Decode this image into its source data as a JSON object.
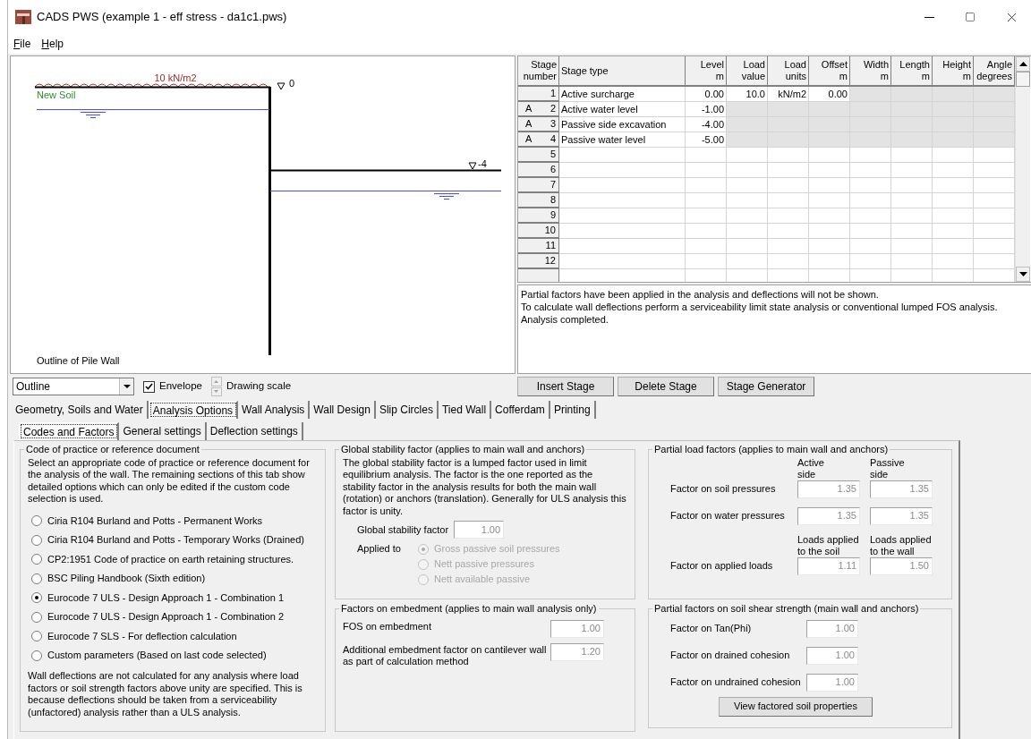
{
  "window": {
    "title": "CADS PWS (example 1 - eff stress - da1c1.pws)"
  },
  "menu": [
    "File",
    "Help"
  ],
  "drawing": {
    "load_label": "10 kN/m2",
    "soil_label": "New Soil",
    "levels": [
      "0",
      "-4"
    ],
    "caption": "Outline of Pile Wall"
  },
  "stage_table": {
    "columns": [
      {
        "lines": [
          "Stage",
          "number"
        ]
      },
      {
        "lines": [
          "Stage type"
        ]
      },
      {
        "lines": [
          "Level",
          "m"
        ]
      },
      {
        "lines": [
          "Load",
          "value"
        ]
      },
      {
        "lines": [
          "Load",
          "units"
        ]
      },
      {
        "lines": [
          "Offset",
          "m"
        ]
      },
      {
        "lines": [
          "Width",
          "m"
        ]
      },
      {
        "lines": [
          "Length",
          "m"
        ]
      },
      {
        "lines": [
          "Height",
          "m"
        ]
      },
      {
        "lines": [
          "Angle",
          "degrees"
        ]
      }
    ],
    "rows": [
      {
        "number": "1",
        "stage_type": "Active surcharge",
        "cells": [
          {
            "text": "0.00",
            "disabled": false
          },
          {
            "text": "10.0",
            "disabled": false
          },
          {
            "text": "kN/m2",
            "disabled": false
          },
          {
            "text": "0.00",
            "disabled": false
          },
          {
            "disabled": true
          },
          {
            "disabled": true
          },
          {
            "disabled": true
          },
          {
            "disabled": true
          }
        ]
      },
      {
        "marker": "A",
        "number": "2",
        "stage_type": "Active water level",
        "cells": [
          {
            "text": "-1.00",
            "disabled": false
          },
          {
            "disabled": true
          },
          {
            "disabled": true
          },
          {
            "disabled": true
          },
          {
            "disabled": true
          },
          {
            "disabled": true
          },
          {
            "disabled": true
          },
          {
            "disabled": true
          }
        ]
      },
      {
        "marker": "A",
        "number": "3",
        "stage_type": "Passive side excavation",
        "cells": [
          {
            "text": "-4.00",
            "disabled": false
          },
          {
            "disabled": true
          },
          {
            "disabled": true
          },
          {
            "disabled": true
          },
          {
            "disabled": true
          },
          {
            "disabled": true
          },
          {
            "disabled": true
          },
          {
            "disabled": true
          }
        ]
      },
      {
        "marker": "A",
        "number": "4",
        "stage_type": "Passive water level",
        "cells": [
          {
            "text": "-5.00",
            "disabled": false
          },
          {
            "disabled": true
          },
          {
            "disabled": true
          },
          {
            "disabled": true
          },
          {
            "disabled": true
          },
          {
            "disabled": true
          },
          {
            "disabled": true
          },
          {
            "disabled": true
          }
        ]
      },
      {
        "number": "5"
      },
      {
        "number": "6"
      },
      {
        "number": "7"
      },
      {
        "number": "8"
      },
      {
        "number": "9"
      },
      {
        "number": "10"
      },
      {
        "number": "11"
      },
      {
        "number": "12"
      }
    ]
  },
  "messages": [
    "Partial factors have been applied in the analysis and deflections will not be shown.",
    "To calculate wall deflections perform a serviceability limit state analysis or conventional lumped FOS analysis.",
    "Analysis completed."
  ],
  "toolbar": {
    "view": "Outline",
    "envelope": {
      "label": "Envelope",
      "checked": true
    },
    "scale_label": "Drawing scale"
  },
  "stage_buttons": [
    "Insert Stage",
    "Delete Stage",
    "Stage Generator"
  ],
  "tabs": [
    {
      "label": "Geometry, Soils and Water",
      "selected": false
    },
    {
      "label": "Analysis Options",
      "selected": true
    },
    {
      "label": "Wall Analysis",
      "selected": false
    },
    {
      "label": "Wall Design",
      "selected": false
    },
    {
      "label": "Slip Circles",
      "selected": false
    },
    {
      "label": "Tied Wall",
      "selected": false
    },
    {
      "label": "Cofferdam",
      "selected": false
    },
    {
      "label": "Printing",
      "selected": false
    }
  ],
  "subtabs": [
    {
      "label": "Codes and Factors",
      "selected": true
    },
    {
      "label": "General settings",
      "selected": false
    },
    {
      "label": "Deflection settings",
      "selected": false
    }
  ],
  "code_group": {
    "title": "Code of practice or reference document",
    "intro": "Select an appropriate code of practice or reference document for the analysis of the wall. The remaining sections of this tab show detailed options which can only be edited if the custom code selection is used.",
    "options": [
      {
        "label": "Ciria R104 Burland and Potts - Permanent Works",
        "selected": false
      },
      {
        "label": "Ciria R104 Burland and Potts - Temporary Works (Drained)",
        "selected": false
      },
      {
        "label": "CP2:1951 Code of practice on earth retaining structures.",
        "selected": false
      },
      {
        "label": "BSC Piling Handbook (Sixth edition)",
        "selected": false
      },
      {
        "label": "Eurocode 7 ULS - Design Approach 1 - Combination 1",
        "selected": true
      },
      {
        "label": "Eurocode 7 ULS - Design Approach 1 - Combination 2",
        "selected": false
      },
      {
        "label": "Eurocode 7 SLS - For deflection calculation",
        "selected": false
      },
      {
        "label": "Custom parameters (Based on last code selected)",
        "selected": false
      }
    ],
    "note": "Wall deflections are not calculated for any analysis where load factors or soil strength factors above unity are specified. This is because deflections should be taken from a serviceability (unfactored) analysis rather than a ULS analysis."
  },
  "stability_group": {
    "title": "Global stability factor (applies to main wall and anchors)",
    "text": "The global stability factor is a lumped factor used in limit equilibrium analysis. The factor is the one reported as the stability factor in the analysis results for both the main wall (rotation) or anchors (translation). Generally for ULS analysis this factor is unity.",
    "field": {
      "label": "Global stability factor",
      "value": "1.00",
      "disabled": true
    },
    "applied_label": "Applied to",
    "disabled": true,
    "options": [
      {
        "label": "Gross passive soil pressures",
        "selected": true
      },
      {
        "label": "Nett passive pressures",
        "selected": false
      },
      {
        "label": "Nett available passive",
        "selected": false
      }
    ]
  },
  "embedment_group": {
    "title": "Factors on embedment (applies to main wall analysis only)",
    "fields": [
      {
        "label": "FOS on embedment",
        "value": "1.00",
        "disabled": true
      },
      {
        "label": "Additional embedment factor on cantilever wall as part of calculation method",
        "value": "1.20",
        "disabled": true
      }
    ]
  },
  "load_group": {
    "title": "Partial load factors (applies to main wall and anchors)",
    "rows": [
      {
        "kind": "header",
        "columns": [
          [
            "Active",
            "side"
          ],
          [
            "Passive",
            "side"
          ]
        ]
      },
      {
        "kind": "factor",
        "label": "Factor on soil pressures",
        "values": [
          {
            "value": "1.35",
            "disabled": true
          },
          {
            "value": "1.35",
            "disabled": true
          }
        ]
      },
      {
        "kind": "factor",
        "label": "Factor on water pressures",
        "values": [
          {
            "value": "1.35",
            "disabled": true
          },
          {
            "value": "1.35",
            "disabled": true
          }
        ]
      },
      {
        "kind": "header",
        "columns": [
          [
            "Loads applied",
            "to the soil"
          ],
          [
            "Loads applied",
            "to the wall"
          ]
        ]
      },
      {
        "kind": "factor",
        "label": "Factor on applied loads",
        "values": [
          {
            "value": "1.11",
            "disabled": true
          },
          {
            "value": "1.50",
            "disabled": true
          }
        ]
      }
    ]
  },
  "strength_group": {
    "title": "Partial factors on soil shear strength (main wall and anchors)",
    "fields": [
      {
        "label": "Factor on Tan(Phi)",
        "value": "1.00",
        "disabled": true
      },
      {
        "label": "Factor on drained cohesion",
        "value": "1.00",
        "disabled": true
      },
      {
        "label": "Factor on undrained cohesion",
        "value": "1.00",
        "disabled": true
      }
    ],
    "button": "View factored soil properties"
  }
}
